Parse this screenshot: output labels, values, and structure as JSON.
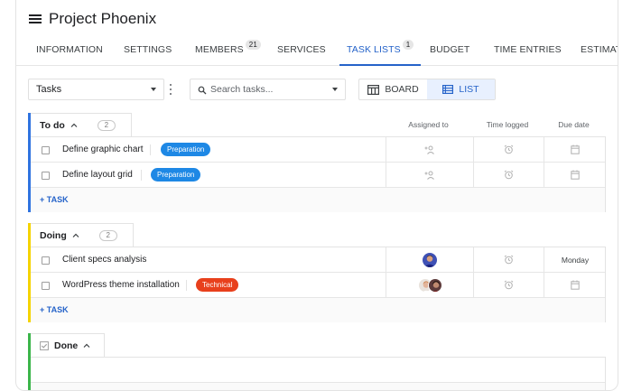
{
  "app": {
    "title": "Project Phoenix"
  },
  "tabs": [
    {
      "label": "INFORMATION",
      "badge": ""
    },
    {
      "label": "SETTINGS",
      "badge": ""
    },
    {
      "label": "MEMBERS",
      "badge": "21"
    },
    {
      "label": "SERVICES",
      "badge": ""
    },
    {
      "label": "TASK LISTS",
      "badge": "1",
      "active": true
    },
    {
      "label": "BUDGET",
      "badge": ""
    },
    {
      "label": "TIME ENTRIES",
      "badge": ""
    },
    {
      "label": "ESTIMATI",
      "badge": ""
    }
  ],
  "toolbar": {
    "list_select": "Tasks",
    "search_placeholder": "Search tasks...",
    "board_label": "BOARD",
    "list_label": "LIST",
    "active_view": "list"
  },
  "columns": {
    "assigned": "Assigned to",
    "time": "Time logged",
    "due": "Due date"
  },
  "groups": [
    {
      "name": "To do",
      "count": "2",
      "color": "#2f73e0",
      "add_label": "+ TASK",
      "tasks": [
        {
          "name": "Define graphic chart",
          "tag": "Preparation",
          "tag_color": "#1e88e5",
          "assignees": [],
          "due": ""
        },
        {
          "name": "Define layout grid",
          "tag": "Preparation",
          "tag_color": "#1e88e5",
          "assignees": [],
          "due": ""
        }
      ]
    },
    {
      "name": "Doing",
      "count": "2",
      "color": "#f5d300",
      "add_label": "+ TASK",
      "tasks": [
        {
          "name": "Client specs analysis",
          "tag": "",
          "tag_color": "",
          "assignees": [
            "person-a"
          ],
          "due": "Monday"
        },
        {
          "name": "WordPress theme installation",
          "tag": "Technical",
          "tag_color": "#e8401c",
          "assignees": [
            "person-b",
            "person-c"
          ],
          "due": ""
        }
      ]
    },
    {
      "name": "Done",
      "count": "",
      "color": "#3bb54a",
      "add_label": "",
      "tasks": []
    }
  ],
  "icons": {
    "menu": "hamburger-icon",
    "search": "search-icon",
    "board": "board-icon",
    "list": "list-icon",
    "assign": "add-user-icon",
    "time": "alarm-clock-icon",
    "due": "calendar-icon",
    "collapse": "chevron-up-icon",
    "done": "checkbox-checked-icon"
  },
  "colors": {
    "accent": "#2563c9"
  }
}
